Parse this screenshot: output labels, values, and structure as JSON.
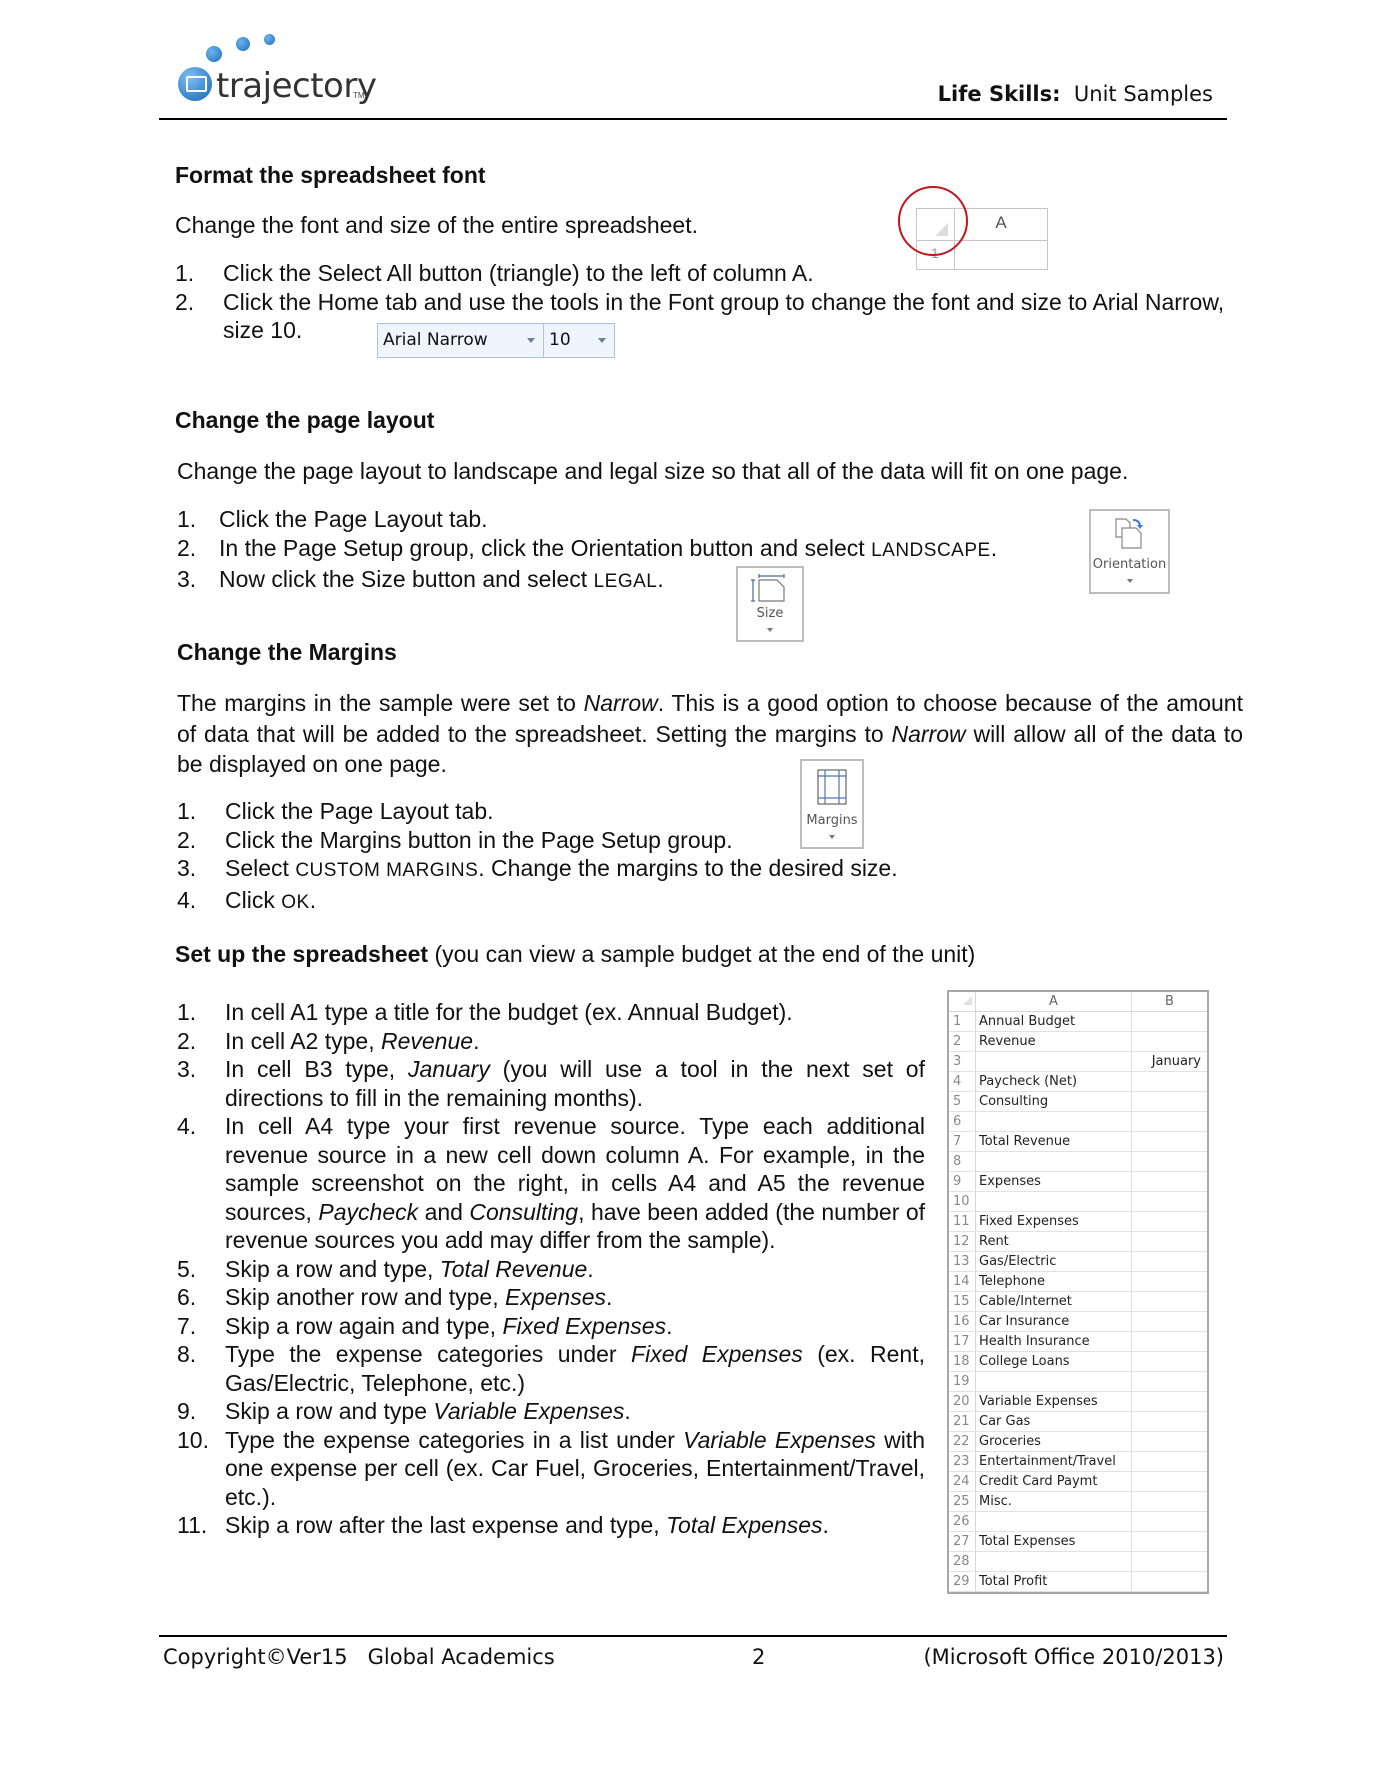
{
  "header": {
    "logo_text": "trajectory",
    "logo_tm": "TM",
    "title_bold": "Life Skills:",
    "title_rest": "Unit Samples"
  },
  "sections": {
    "font": {
      "heading": "Format the spreadsheet font",
      "intro": "Change the font and size of the entire spreadsheet.",
      "steps": [
        {
          "n": "1.",
          "text": "Click the Select All button (triangle) to the left of column A."
        },
        {
          "n": "2.",
          "text": "Click the Home tab and use the tools in the Font group to change the font and size to Arial Narrow,"
        },
        {
          "n": "",
          "text": "size 10."
        }
      ],
      "font_combo": {
        "font": "Arial Narrow",
        "size": "10"
      },
      "select_all_image": {
        "column": "A",
        "row": "1"
      }
    },
    "layout": {
      "heading": "Change the page layout",
      "intro": "Change the page layout to landscape and legal size so that all of the data will fit on one page.",
      "step1": {
        "n": "1.",
        "text": "Click the Page Layout tab."
      },
      "step2": {
        "n": "2.",
        "text": "In the Page Setup group, click the Orientation button and select ",
        "sc": "LANDSCAPE",
        "end": "."
      },
      "step3": {
        "n": "3.",
        "text": "Now click the Size button and select ",
        "sc": "LEGAL",
        "end": "."
      },
      "orientation_label": "Orientation",
      "size_label": "Size"
    },
    "margins": {
      "heading": "Change the Margins",
      "para_a": "The margins in the sample were set to ",
      "para_i1": "Narrow",
      "para_b": ". This is a good option to choose because of the amount of data that will be added to the spreadsheet. Setting the margins to ",
      "para_i2": "Narrow",
      "para_c": " will allow all of the data to be displayed on one page.",
      "step1": {
        "n": "1.",
        "text": "Click the Page Layout tab."
      },
      "step2": {
        "n": "2.",
        "text": "Click the Margins button in the Page Setup group."
      },
      "step3": {
        "n": "3.",
        "pre": "Select ",
        "sc": "CUSTOM MARGINS",
        "text": ". Change the margins to the desired size."
      },
      "step4": {
        "n": "4.",
        "pre": "Click ",
        "sc": "OK",
        "text": "."
      },
      "margins_label": "Margins"
    },
    "setup": {
      "heading_bold": "Set up the spreadsheet",
      "heading_rest": " (you can view a sample budget at the end of the unit)",
      "s1": {
        "n": "1.",
        "text": "In cell A1 type a title for the budget (ex. Annual Budget)."
      },
      "s2": {
        "n": "2.",
        "pre": "In cell A2 type, ",
        "i": "Revenue",
        "post": "."
      },
      "s3": {
        "n": "3.",
        "pre": "In cell B3 type, ",
        "i": "January",
        "post": " (you will use a tool in the next set of directions to fill in the remaining months)."
      },
      "s4": {
        "n": "4.",
        "pre": "In cell A4 type your first revenue source. Type each additional revenue source in a new cell down column A. For example, in the sample screenshot on the right, in cells A4 and A5 the revenue sources, ",
        "i1": "Paycheck",
        "mid": " and ",
        "i2": "Consulting",
        "post": ", have been added (the number of revenue sources you add may differ from the sample)."
      },
      "s5": {
        "n": "5.",
        "pre": "Skip a row and type, ",
        "i": "Total Revenue",
        "post": "."
      },
      "s6": {
        "n": "6.",
        "pre": "Skip another row and type, ",
        "i": "Expenses",
        "post": "."
      },
      "s7": {
        "n": "7.",
        "pre": "Skip a row again and type, ",
        "i": "Fixed Expenses",
        "post": "."
      },
      "s8": {
        "n": "8.",
        "pre": "Type the expense categories under ",
        "i": "Fixed Expenses",
        "post": " (ex. Rent, Gas/Electric, Telephone, etc.)"
      },
      "s9": {
        "n": "9.",
        "pre": "Skip a row and type ",
        "i": "Variable Expenses",
        "post": "."
      },
      "s10": {
        "n": "10.",
        "pre": "Type the expense categories in a list under ",
        "i": "Variable Expenses",
        "post": " with one expense per cell (ex. Car Fuel, Groceries, Entertainment/Travel, etc.)."
      },
      "s11": {
        "n": "11.",
        "pre": "Skip a row after the last expense and type, ",
        "i": "Total Expenses",
        "post": "."
      }
    }
  },
  "sheet": {
    "col_a": "A",
    "col_b": "B",
    "rows": [
      {
        "n": "1",
        "a": "Annual Budget",
        "b": ""
      },
      {
        "n": "2",
        "a": "Revenue",
        "b": ""
      },
      {
        "n": "3",
        "a": "",
        "b": "January"
      },
      {
        "n": "4",
        "a": "Paycheck (Net)",
        "b": ""
      },
      {
        "n": "5",
        "a": "Consulting",
        "b": ""
      },
      {
        "n": "6",
        "a": "",
        "b": ""
      },
      {
        "n": "7",
        "a": "Total Revenue",
        "b": ""
      },
      {
        "n": "8",
        "a": "",
        "b": ""
      },
      {
        "n": "9",
        "a": "Expenses",
        "b": ""
      },
      {
        "n": "10",
        "a": "",
        "b": ""
      },
      {
        "n": "11",
        "a": "Fixed Expenses",
        "b": ""
      },
      {
        "n": "12",
        "a": "Rent",
        "b": ""
      },
      {
        "n": "13",
        "a": "Gas/Electric",
        "b": ""
      },
      {
        "n": "14",
        "a": "Telephone",
        "b": ""
      },
      {
        "n": "15",
        "a": "Cable/Internet",
        "b": ""
      },
      {
        "n": "16",
        "a": "Car Insurance",
        "b": ""
      },
      {
        "n": "17",
        "a": "Health Insurance",
        "b": ""
      },
      {
        "n": "18",
        "a": "College Loans",
        "b": ""
      },
      {
        "n": "19",
        "a": "",
        "b": ""
      },
      {
        "n": "20",
        "a": "Variable Expenses",
        "b": ""
      },
      {
        "n": "21",
        "a": "Car Gas",
        "b": ""
      },
      {
        "n": "22",
        "a": "Groceries",
        "b": ""
      },
      {
        "n": "23",
        "a": "Entertainment/Travel",
        "b": ""
      },
      {
        "n": "24",
        "a": "Credit Card Paymt",
        "b": ""
      },
      {
        "n": "25",
        "a": "Misc.",
        "b": ""
      },
      {
        "n": "26",
        "a": "",
        "b": ""
      },
      {
        "n": "27",
        "a": "Total Expenses",
        "b": ""
      },
      {
        "n": "28",
        "a": "",
        "b": ""
      },
      {
        "n": "29",
        "a": "Total Profit",
        "b": ""
      }
    ]
  },
  "footer": {
    "left": "Copyright©Ver15   Global Academics",
    "page": "2",
    "right": "(Microsoft Office 2010/2013)"
  },
  "colors": {
    "logo_blue": "#1a6fc0",
    "circle_red": "#c0161c"
  }
}
